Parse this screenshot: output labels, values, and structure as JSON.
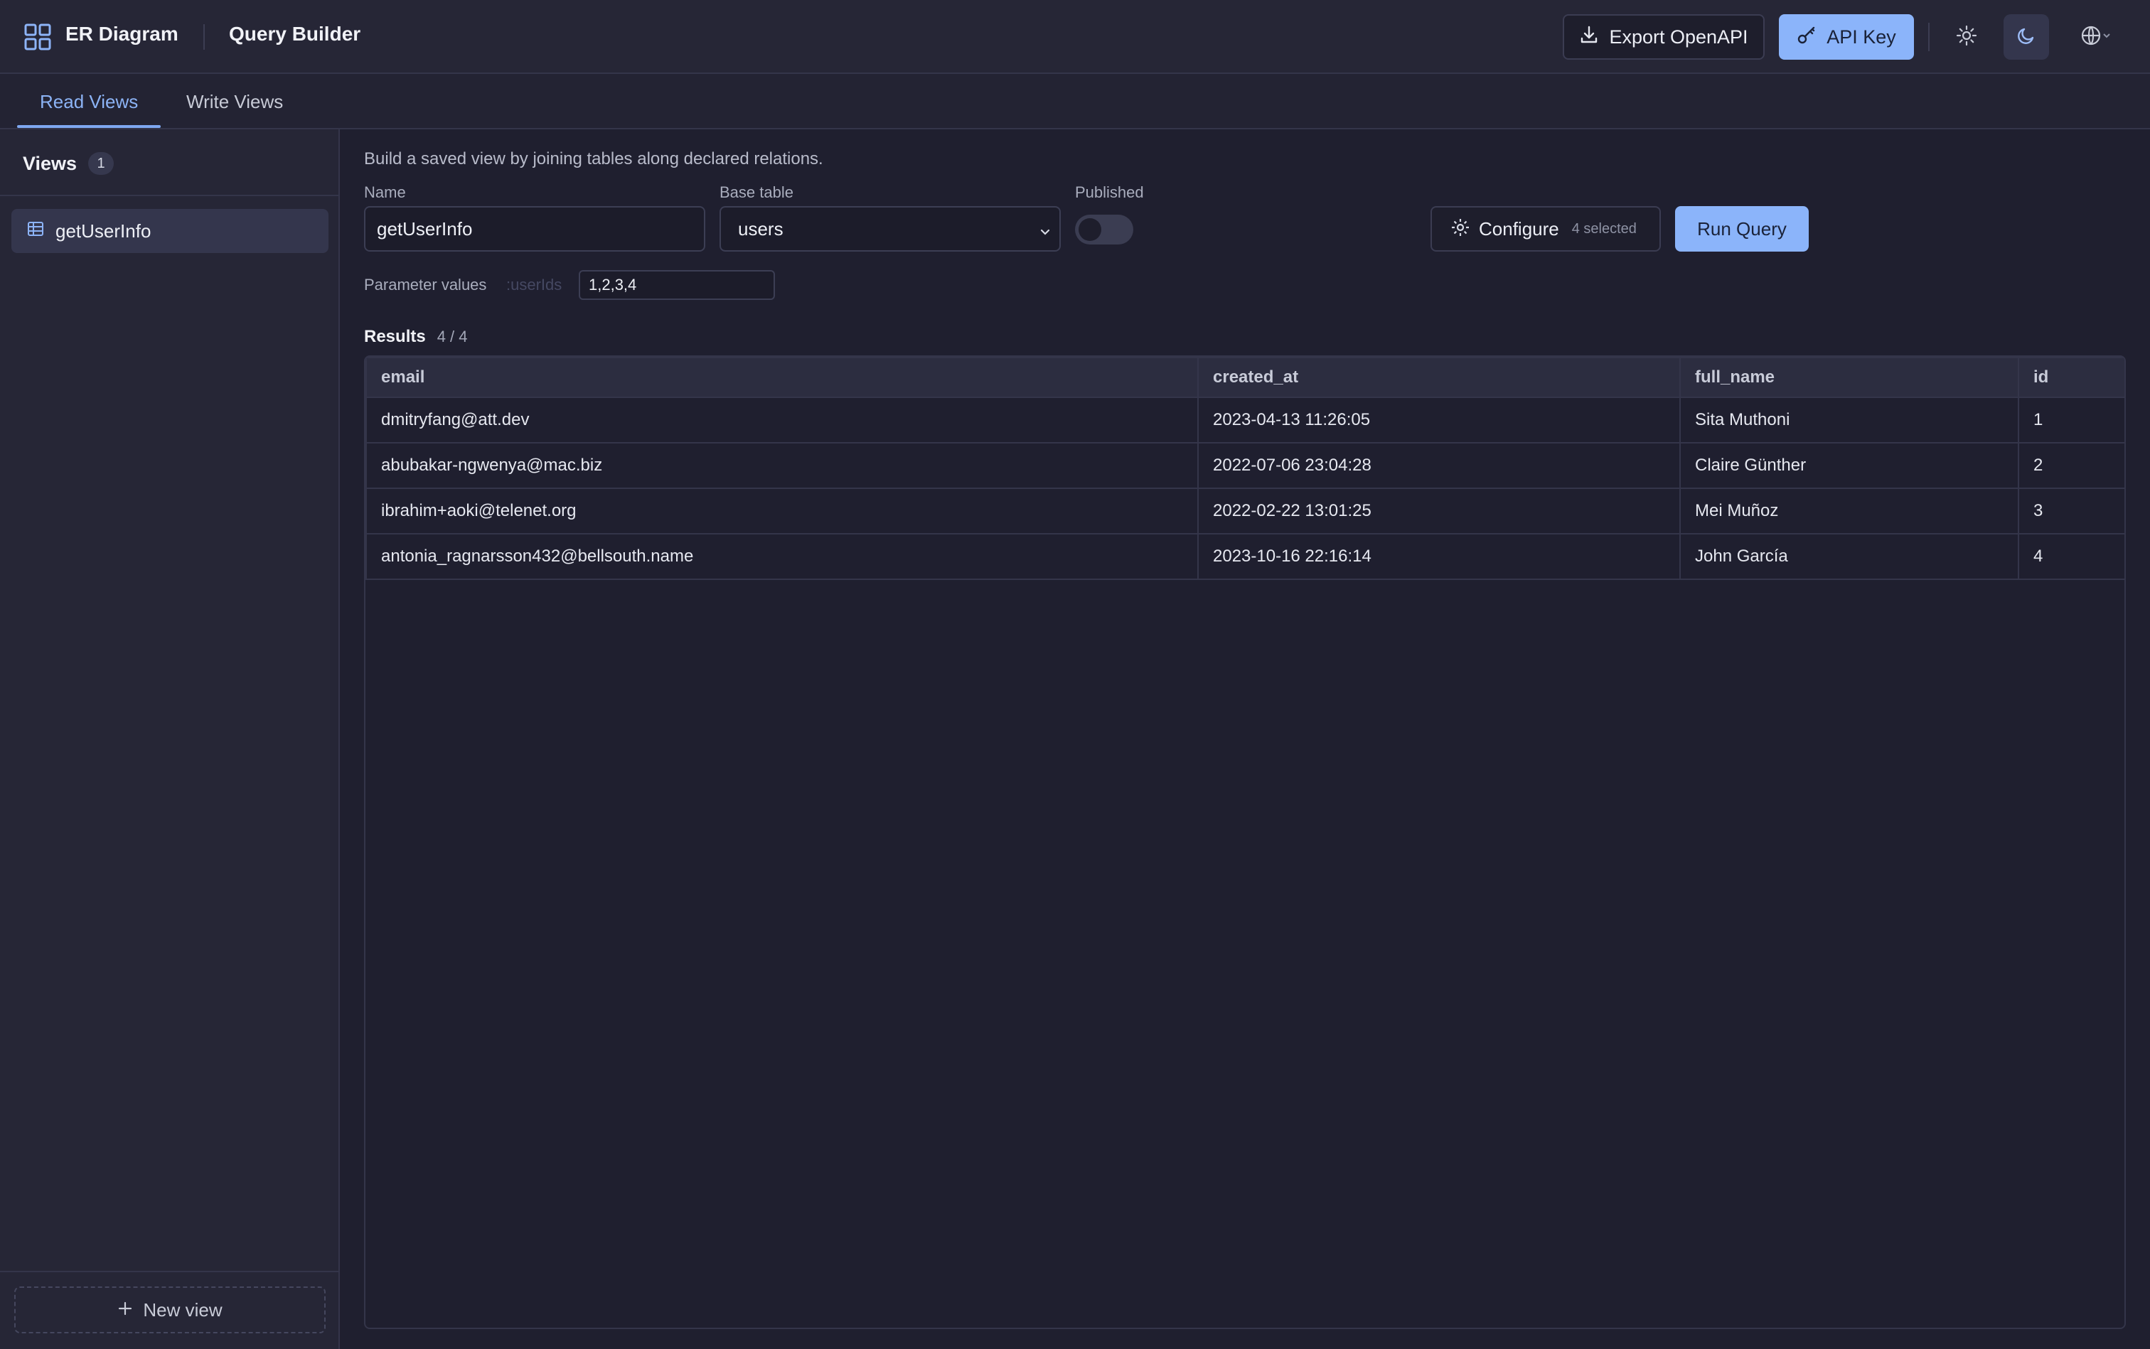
{
  "header": {
    "brand": "ER Diagram",
    "page": "Query Builder",
    "export_label": "Export OpenAPI",
    "api_key_label": "API Key"
  },
  "tabs": [
    {
      "label": "Read Views",
      "active": true
    },
    {
      "label": "Write Views",
      "active": false
    }
  ],
  "sidebar": {
    "title": "Views",
    "count": "1",
    "items": [
      {
        "label": "getUserInfo",
        "selected": true
      }
    ],
    "new_view_label": "New view"
  },
  "main": {
    "description": "Build a saved view by joining tables along declared relations.",
    "name_label": "Name",
    "name_value": "getUserInfo",
    "base_table_label": "Base table",
    "base_table_value": "users",
    "published_label": "Published",
    "published": false,
    "configure_label": "Configure",
    "configure_selected": "4 selected",
    "run_label": "Run Query",
    "param_label": "Parameter values",
    "param_name": ":userIds",
    "param_value": "1,2,3,4"
  },
  "results": {
    "title": "Results",
    "count": "4 / 4",
    "columns": [
      "email",
      "created_at",
      "full_name",
      "id"
    ],
    "rows": [
      [
        "dmitryfang@att.dev",
        "2023-04-13 11:26:05",
        "Sita Muthoni",
        "1"
      ],
      [
        "abubakar-ngwenya@mac.biz",
        "2022-07-06 23:04:28",
        "Claire Günther",
        "2"
      ],
      [
        "ibrahim+aoki@telenet.org",
        "2022-02-22 13:01:25",
        "Mei Muñoz",
        "3"
      ],
      [
        "antonia_ragnarsson432@bellsouth.name",
        "2023-10-16 22:16:14",
        "John García",
        "4"
      ]
    ]
  },
  "icons": {
    "logo": "grid-icon",
    "export": "download-icon",
    "api_key": "key-icon",
    "light_theme": "sun-icon",
    "dark_theme": "moon-icon",
    "language": "globe-icon",
    "view_item": "table-icon",
    "configure": "gear-icon",
    "new_view": "plus-icon"
  },
  "colors": {
    "accent": "#8bb4fa",
    "background": "#1f1f2f",
    "panel": "#262636"
  }
}
